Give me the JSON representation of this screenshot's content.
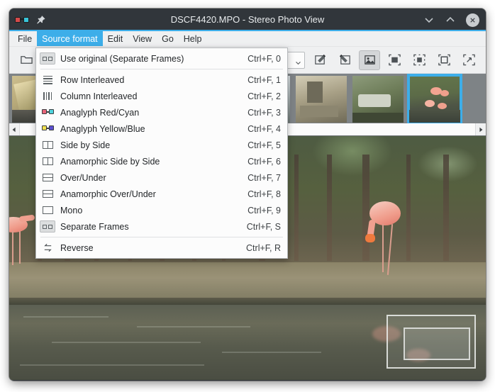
{
  "window": {
    "title": "DSCF4420.MPO - Stereo Photo View",
    "app_icon": "stereo-glasses-icon",
    "pin_icon": "pin-icon",
    "controls": {
      "minimize": "chevron-down-icon",
      "maximize": "chevron-up-icon",
      "close": "close-circle-icon"
    },
    "accent_color": "#3daee9",
    "titlebar_color": "#31363b"
  },
  "menubar": {
    "items": [
      {
        "label": "File",
        "active": false
      },
      {
        "label": "Source format",
        "active": true
      },
      {
        "label": "Edit",
        "active": false
      },
      {
        "label": "View",
        "active": false
      },
      {
        "label": "Go",
        "active": false
      },
      {
        "label": "Help",
        "active": false
      }
    ]
  },
  "toolbar": {
    "open_icon": "folder-open-icon",
    "combo_arrow_icon": "chevron-down-icon",
    "buttons": [
      {
        "name": "rotate-left-button",
        "icon": "image-rotate-left-icon",
        "checked": false
      },
      {
        "name": "rotate-right-button",
        "icon": "image-rotate-right-icon",
        "checked": false
      },
      {
        "name": "fit-image-button",
        "icon": "image-picture-icon",
        "checked": true
      },
      {
        "name": "zoom-fit-button",
        "icon": "fit-frame-icon",
        "checked": false
      },
      {
        "name": "zoom-original-button",
        "icon": "zoom-original-icon",
        "checked": false
      },
      {
        "name": "fit-width-button",
        "icon": "fit-square-icon",
        "checked": false
      },
      {
        "name": "fullscreen-button",
        "icon": "fullscreen-expand-icon",
        "checked": false
      }
    ]
  },
  "thumbnails": {
    "scroll_left_icon": "triangle-left-icon",
    "scroll_right_icon": "triangle-right-icon",
    "items": [
      {
        "name": "thumb-1",
        "selected": false
      },
      {
        "name": "thumb-2",
        "selected": false
      },
      {
        "name": "thumb-3",
        "selected": false
      },
      {
        "name": "thumb-4",
        "selected": false
      },
      {
        "name": "thumb-5",
        "selected": false
      },
      {
        "name": "thumb-6",
        "selected": false
      },
      {
        "name": "thumb-7",
        "selected": false
      },
      {
        "name": "thumb-8",
        "selected": true
      }
    ],
    "selected_border_color": "#3daee9"
  },
  "popup_menu": {
    "title": "Source format",
    "items": [
      {
        "label": "Use original (Separate Frames)",
        "accel": "Ctrl+F, 0",
        "icon": "two-frames-icon",
        "icon_boxed": true,
        "separator_after": true
      },
      {
        "label": "Row Interleaved",
        "accel": "Ctrl+F, 1",
        "icon": "row-interleaved-icon",
        "icon_boxed": false,
        "separator_after": false
      },
      {
        "label": "Column Interleaved",
        "accel": "Ctrl+F, 2",
        "icon": "column-interleaved-icon",
        "icon_boxed": false,
        "separator_after": false
      },
      {
        "label": "Anaglyph Red/Cyan",
        "accel": "Ctrl+F, 3",
        "icon": "anaglyph-red-cyan-icon",
        "icon_boxed": false,
        "separator_after": false
      },
      {
        "label": "Anaglyph Yellow/Blue",
        "accel": "Ctrl+F, 4",
        "icon": "anaglyph-yellow-blue-icon",
        "icon_boxed": false,
        "separator_after": false
      },
      {
        "label": "Side by Side",
        "accel": "Ctrl+F, 5",
        "icon": "side-by-side-icon",
        "icon_boxed": false,
        "separator_after": false
      },
      {
        "label": "Anamorphic Side by Side",
        "accel": "Ctrl+F, 6",
        "icon": "anamorphic-side-by-side-icon",
        "icon_boxed": false,
        "separator_after": false
      },
      {
        "label": "Over/Under",
        "accel": "Ctrl+F, 7",
        "icon": "over-under-icon",
        "icon_boxed": false,
        "separator_after": false
      },
      {
        "label": "Anamorphic Over/Under",
        "accel": "Ctrl+F, 8",
        "icon": "anamorphic-over-under-icon",
        "icon_boxed": false,
        "separator_after": false
      },
      {
        "label": "Mono",
        "accel": "Ctrl+F, 9",
        "icon": "mono-icon",
        "icon_boxed": false,
        "separator_after": false
      },
      {
        "label": "Separate Frames",
        "accel": "Ctrl+F, S",
        "icon": "two-frames-icon",
        "icon_boxed": true,
        "separator_after": true
      },
      {
        "label": "Reverse",
        "accel": "Ctrl+F, R",
        "icon": "swap-arrows-icon",
        "icon_boxed": false,
        "separator_after": false
      }
    ]
  },
  "canvas": {
    "name": "photo-viewport",
    "subject": "flamingos at water edge",
    "navigator": {
      "name": "navigator-overlay",
      "viewport_rect": "navigator-viewport-rect"
    }
  }
}
